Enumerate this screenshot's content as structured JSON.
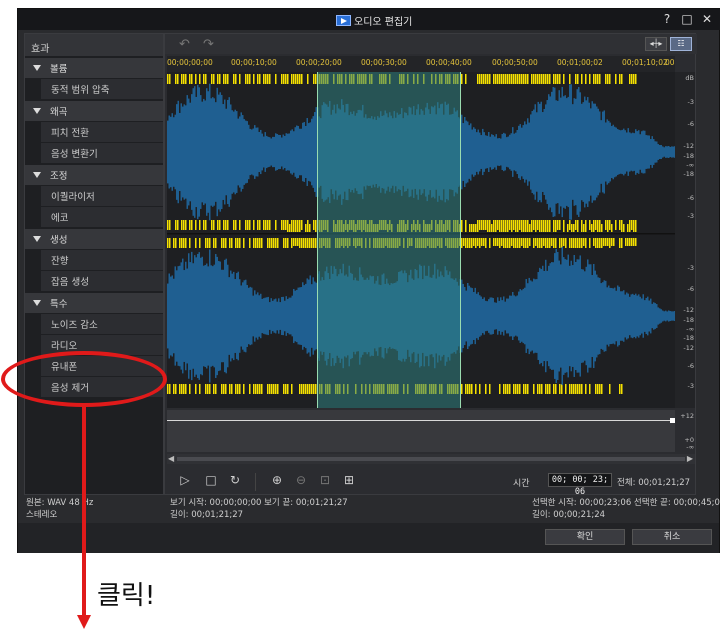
{
  "window": {
    "title": "오디오 편집기",
    "controls": {
      "help": "?",
      "maximize": "□",
      "close": "✕"
    }
  },
  "effects_panel": {
    "header": "효과",
    "categories": [
      {
        "label": "볼륨",
        "items": [
          "동적 범위 압축"
        ]
      },
      {
        "label": "왜곡",
        "items": [
          "피치 전환",
          "음성 변환기"
        ]
      },
      {
        "label": "조정",
        "items": [
          "이퀄라이저",
          "에코"
        ]
      },
      {
        "label": "생성",
        "items": [
          "잔향",
          "잡음 생성"
        ]
      },
      {
        "label": "특수",
        "items": [
          "노이즈 감소",
          "라디오",
          "유내폰",
          "음성 제거"
        ]
      }
    ]
  },
  "toolbar": {
    "undo_icon": "undo-icon",
    "redo_icon": "redo-icon",
    "view1": "◂┼▸",
    "view2": "☷"
  },
  "ruler": {
    "labels": [
      "00;00;00;00",
      "00;00;10;00",
      "00;00;20;00",
      "00;00;30;00",
      "00;00;40;00",
      "00;00;50;00",
      "00;01;00;02",
      "00;01;10;02",
      "00"
    ]
  },
  "db_scale": {
    "unit": "dB",
    "top_channel": [
      "-3",
      "-6",
      "-12",
      "-18",
      "-∞",
      "-18",
      "-6",
      "-3"
    ],
    "bottom_channel": [
      "-3",
      "-6",
      "-12",
      "-18",
      "-∞",
      "-18",
      "-12",
      "-6",
      "-3"
    ],
    "envelope": [
      "+12",
      "+0",
      "-∞"
    ]
  },
  "transport": {
    "time_label": "시간",
    "current_time": "00; 00; 23; 06",
    "total": "전체: 00;01;21;27"
  },
  "info": {
    "source": "원본: WAV 48 Hz",
    "channels": "스테레오",
    "view": "보기 시작: 00;00;00;00    보기 끝: 00;01;21;27",
    "view_length": "길이: 00;01;21;27",
    "selection": "선택한 시작: 00;00;23;06    선택한 끝: 00;00;45;00",
    "selection_length": "길이: 00;00;21;24"
  },
  "buttons": {
    "ok": "확인",
    "cancel": "취소"
  },
  "annotation": {
    "text": "클릭!"
  },
  "colors": {
    "wave_blue": "#1f5f91",
    "selection": "#2f7f7f",
    "clip": "#f5e100",
    "annotation": "#e01a1a"
  }
}
